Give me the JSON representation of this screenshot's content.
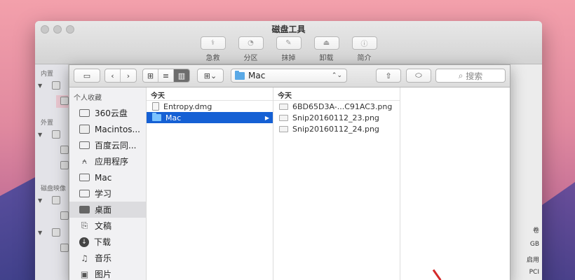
{
  "disk_utility": {
    "title": "磁盘工具",
    "toolbar": [
      {
        "label": "急救",
        "icon": "stethoscope-icon",
        "glyph": "⚕"
      },
      {
        "label": "分区",
        "icon": "partition-icon",
        "glyph": "◔"
      },
      {
        "label": "抹掉",
        "icon": "erase-icon",
        "glyph": "✎"
      },
      {
        "label": "卸载",
        "icon": "unmount-icon",
        "glyph": "⏏"
      },
      {
        "label": "简介",
        "icon": "info-icon",
        "glyph": "ⓘ"
      }
    ],
    "sidebar_sections": {
      "internal": "内置",
      "external": "外置",
      "disk_images": "磁盘映像"
    },
    "right_fragments": [
      "卷",
      "GB",
      "启用",
      "PCI"
    ]
  },
  "panel": {
    "path_popup": "Mac",
    "search_placeholder": "搜索",
    "sidebar": {
      "header": "个人收藏",
      "items": [
        {
          "label": "360云盘",
          "icon": "folder-icon"
        },
        {
          "label": "Macintos...",
          "icon": "disk-icon"
        },
        {
          "label": "百度云同...",
          "icon": "folder-icon"
        },
        {
          "label": "应用程序",
          "icon": "applications-icon"
        },
        {
          "label": "Mac",
          "icon": "folder-icon"
        },
        {
          "label": "学习",
          "icon": "folder-icon"
        },
        {
          "label": "桌面",
          "icon": "desktop-icon"
        },
        {
          "label": "文稿",
          "icon": "documents-icon"
        },
        {
          "label": "下载",
          "icon": "downloads-icon"
        },
        {
          "label": "音乐",
          "icon": "music-icon"
        },
        {
          "label": "图片",
          "icon": "pictures-icon"
        }
      ]
    },
    "columns": [
      {
        "header": "今天",
        "rows": [
          {
            "label": "Entropy.dmg",
            "type": "file"
          },
          {
            "label": "Mac",
            "type": "folder",
            "selected": true
          }
        ]
      },
      {
        "header": "今天",
        "rows": [
          {
            "label": "6BD65D3A-...C91AC3.png",
            "type": "image"
          },
          {
            "label": "Snip20160112_23.png",
            "type": "image"
          },
          {
            "label": "Snip20160112_24.png",
            "type": "image"
          }
        ]
      }
    ]
  }
}
